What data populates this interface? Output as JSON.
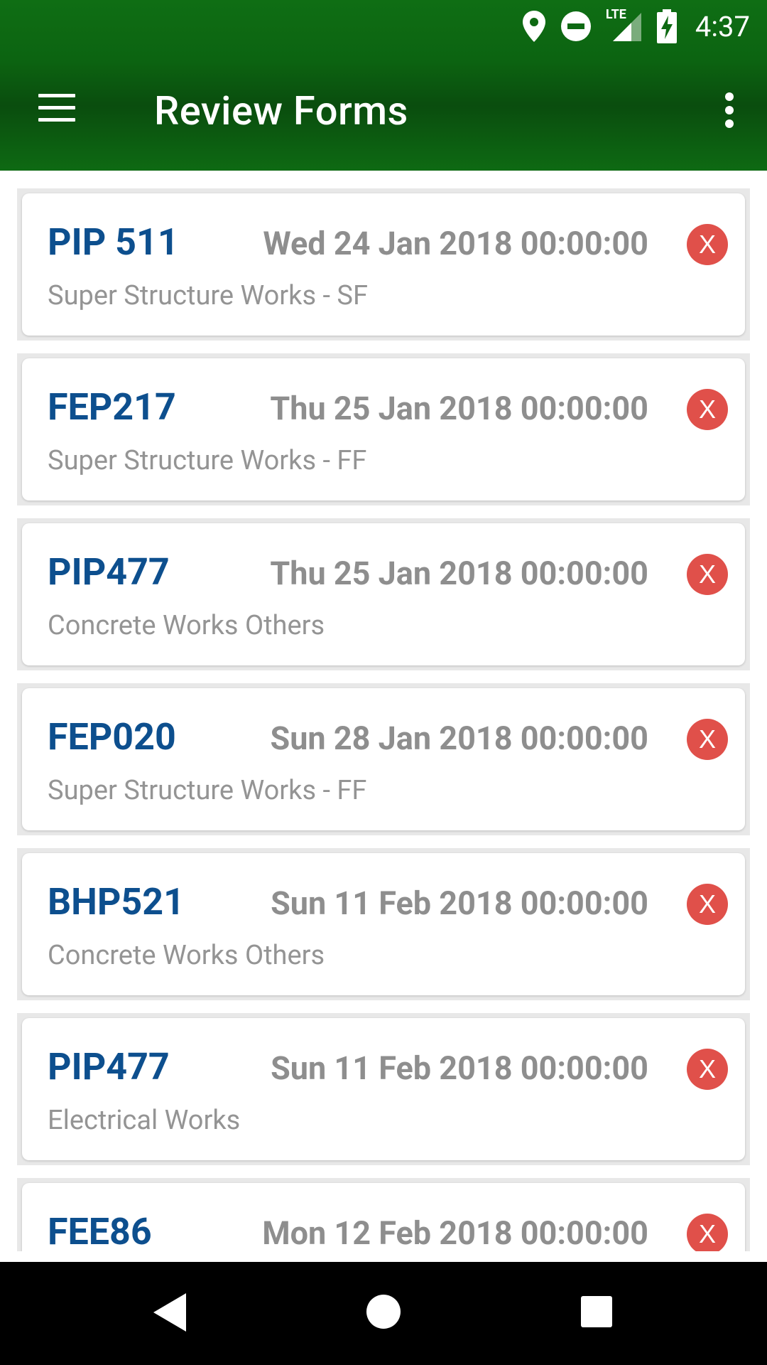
{
  "status": {
    "time": "4:37",
    "network_label": "LTE"
  },
  "toolbar": {
    "title": "Review Forms"
  },
  "forms": [
    {
      "code": "PIP 511",
      "date": "Wed 24 Jan 2018 00:00:00",
      "description": "Super Structure Works - SF",
      "delete_label": "X"
    },
    {
      "code": "FEP217",
      "date": "Thu 25 Jan 2018 00:00:00",
      "description": "Super Structure Works - FF",
      "delete_label": "X"
    },
    {
      "code": "PIP477",
      "date": "Thu 25 Jan 2018 00:00:00",
      "description": "Concrete Works Others",
      "delete_label": "X"
    },
    {
      "code": "FEP020",
      "date": "Sun 28 Jan 2018 00:00:00",
      "description": "Super Structure Works - FF",
      "delete_label": "X"
    },
    {
      "code": "BHP521",
      "date": "Sun 11 Feb 2018 00:00:00",
      "description": "Concrete Works Others",
      "delete_label": "X"
    },
    {
      "code": "PIP477",
      "date": "Sun 11 Feb 2018 00:00:00",
      "description": "Electrical Works",
      "delete_label": "X"
    },
    {
      "code": "FEE86",
      "date": "Mon 12 Feb 2018 00:00:00",
      "description": "",
      "delete_label": "X"
    }
  ],
  "colors": {
    "appbar_green": "#0c6411",
    "code_blue": "#0d4f8e",
    "delete_red": "#e0504a"
  }
}
